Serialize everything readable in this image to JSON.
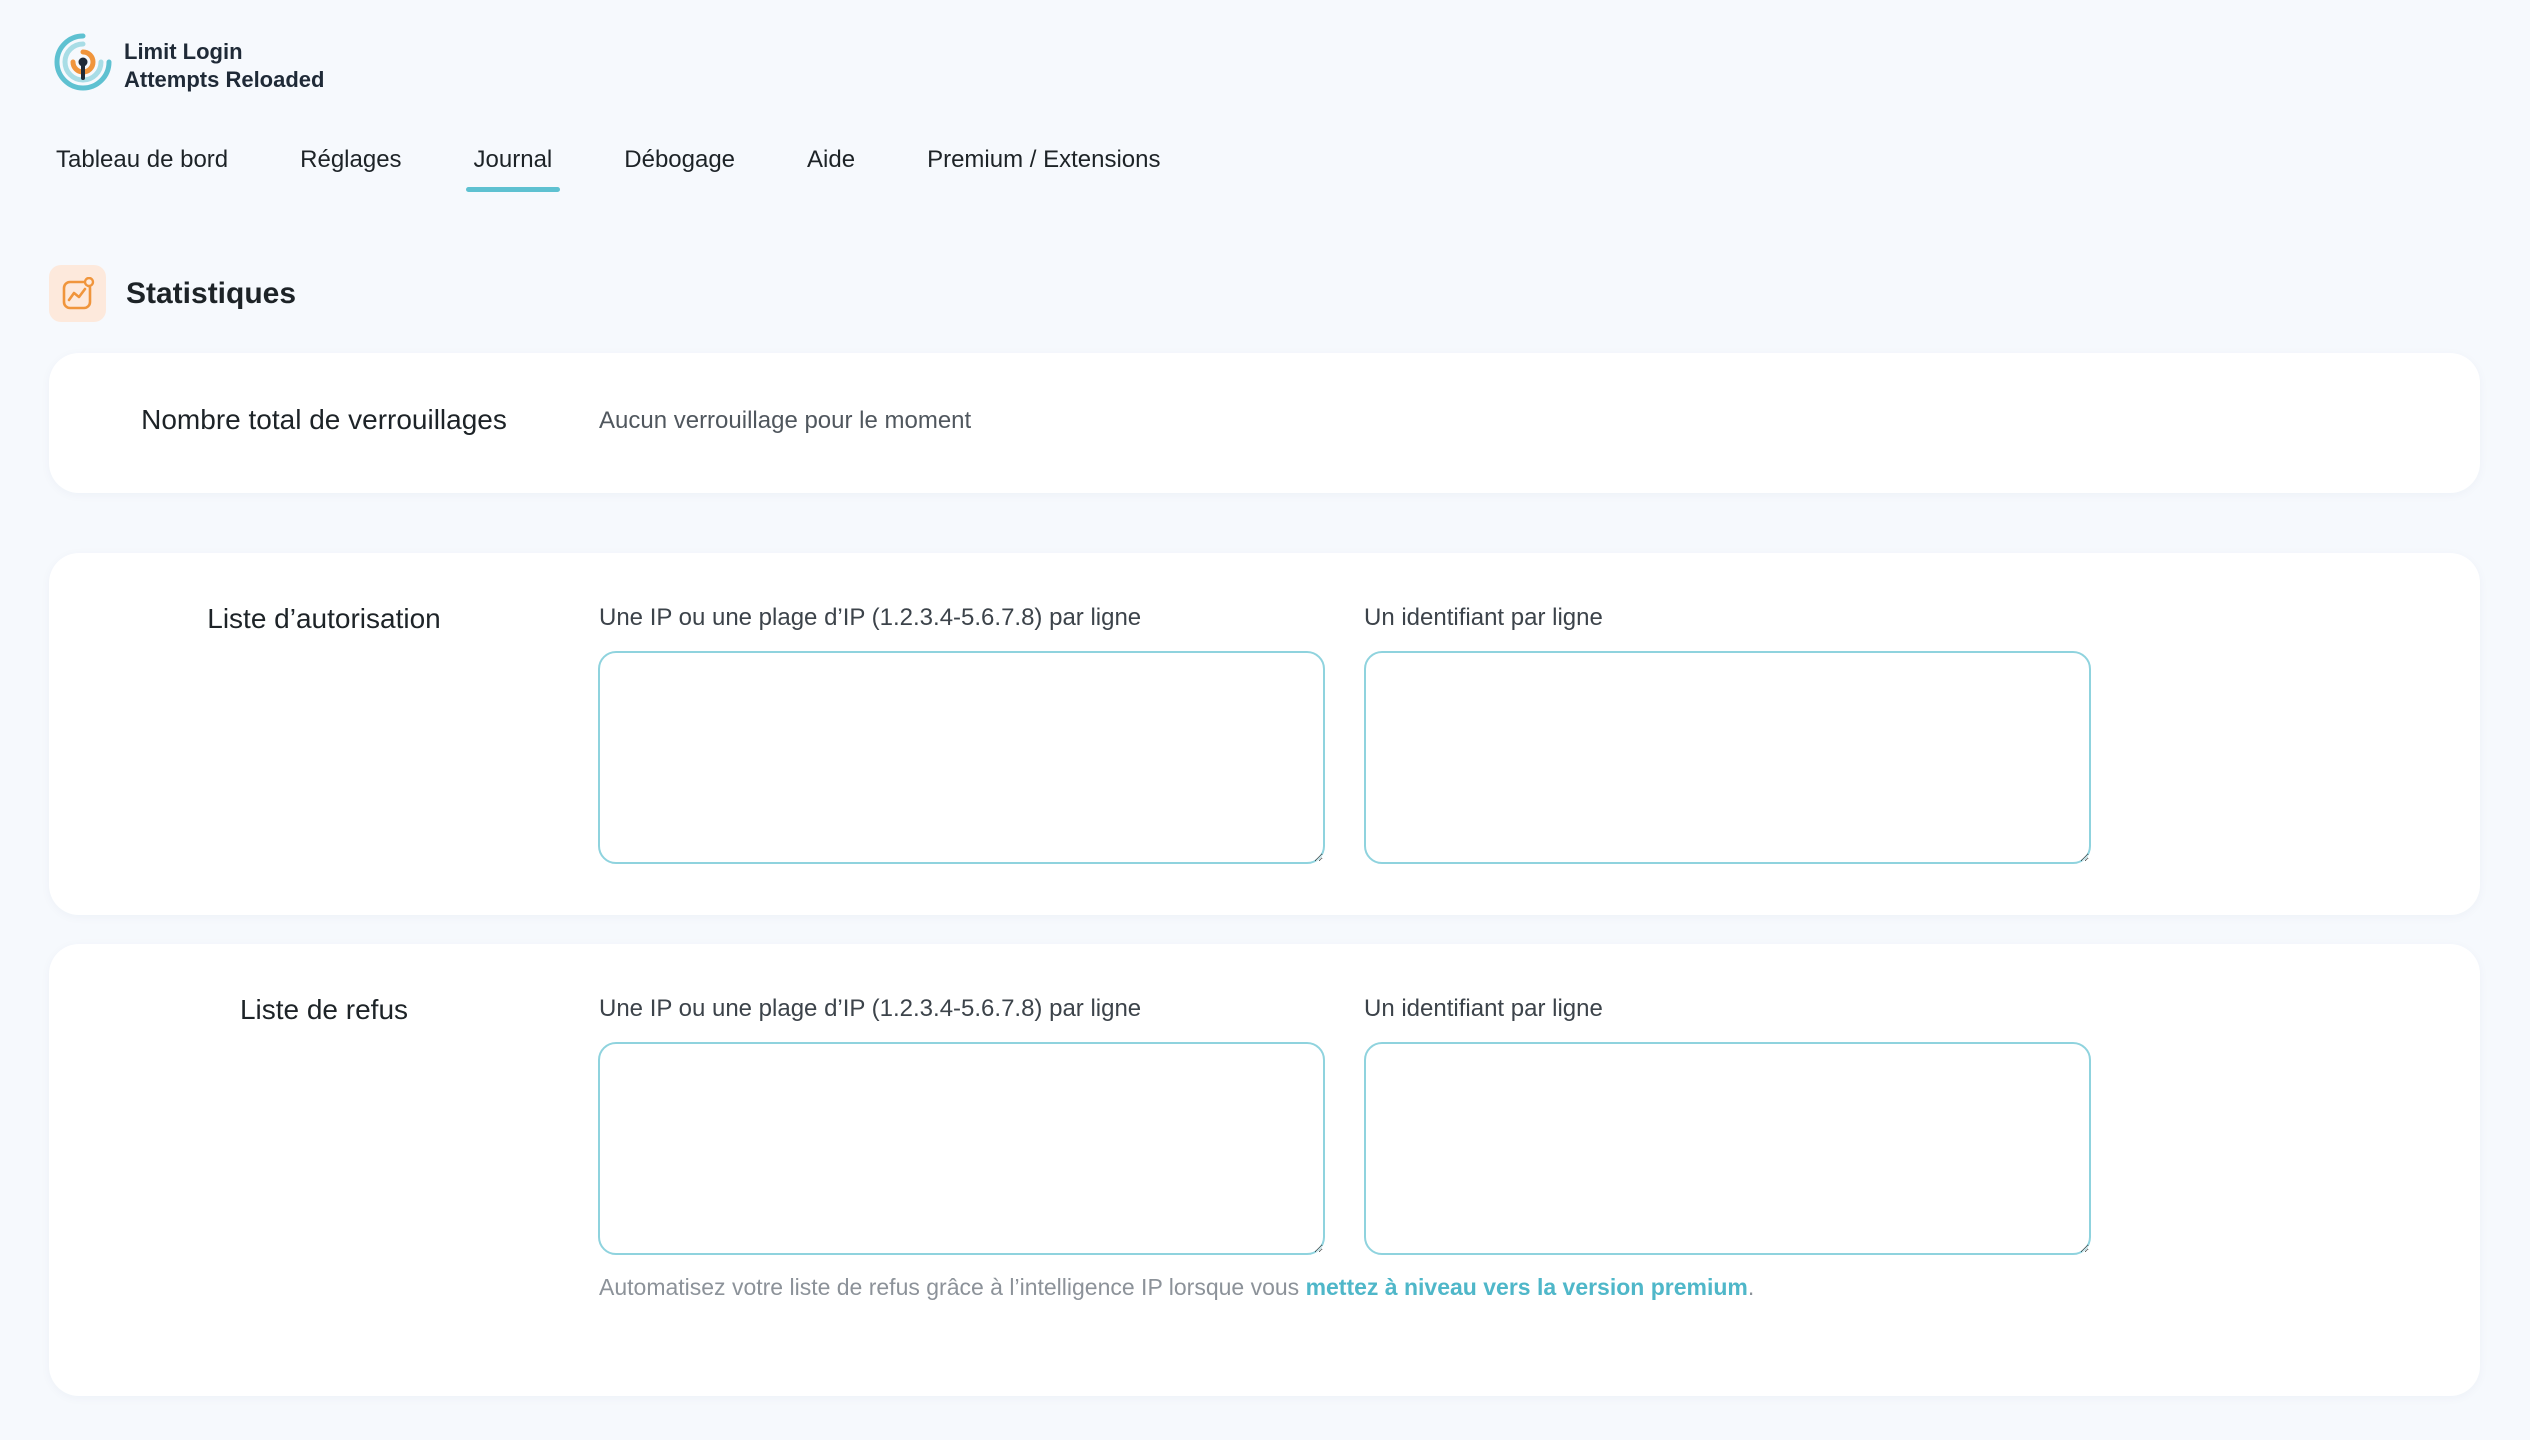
{
  "brand": {
    "line1": "Limit Login",
    "line2": "Attempts Reloaded",
    "colors": {
      "teal": "#5ec1d1",
      "orange": "#f0953c",
      "dark": "#1f2a37"
    }
  },
  "tabs": [
    {
      "label": "Tableau de bord",
      "active": false
    },
    {
      "label": "Réglages",
      "active": false
    },
    {
      "label": "Journal",
      "active": true
    },
    {
      "label": "Débogage",
      "active": false
    },
    {
      "label": "Aide",
      "active": false
    },
    {
      "label": "Premium / Extensions",
      "active": false
    }
  ],
  "section": {
    "title": "Statistiques",
    "icon": "chart-icon"
  },
  "total_lockouts": {
    "label": "Nombre total de verrouillages",
    "value": "Aucun verrouillage pour le moment"
  },
  "allow_list": {
    "label": "Liste d’autorisation",
    "ip_label": "Une IP ou une plage d’IP (1.2.3.4-5.6.7.8) par ligne",
    "ip_value": "",
    "user_label": "Un identifiant par ligne",
    "user_value": ""
  },
  "deny_list": {
    "label": "Liste de refus",
    "ip_label": "Une IP ou une plage d’IP (1.2.3.4-5.6.7.8) par ligne",
    "ip_value": "",
    "user_label": "Un identifiant par ligne",
    "user_value": "",
    "note_text": "Automatisez votre liste de refus grâce à l’intelligence IP lorsque vous ",
    "note_link": "mettez à niveau vers la version premium",
    "note_end": "."
  },
  "accent_color": "#5ec1d1",
  "icon_bg_color": "#fde9dc"
}
